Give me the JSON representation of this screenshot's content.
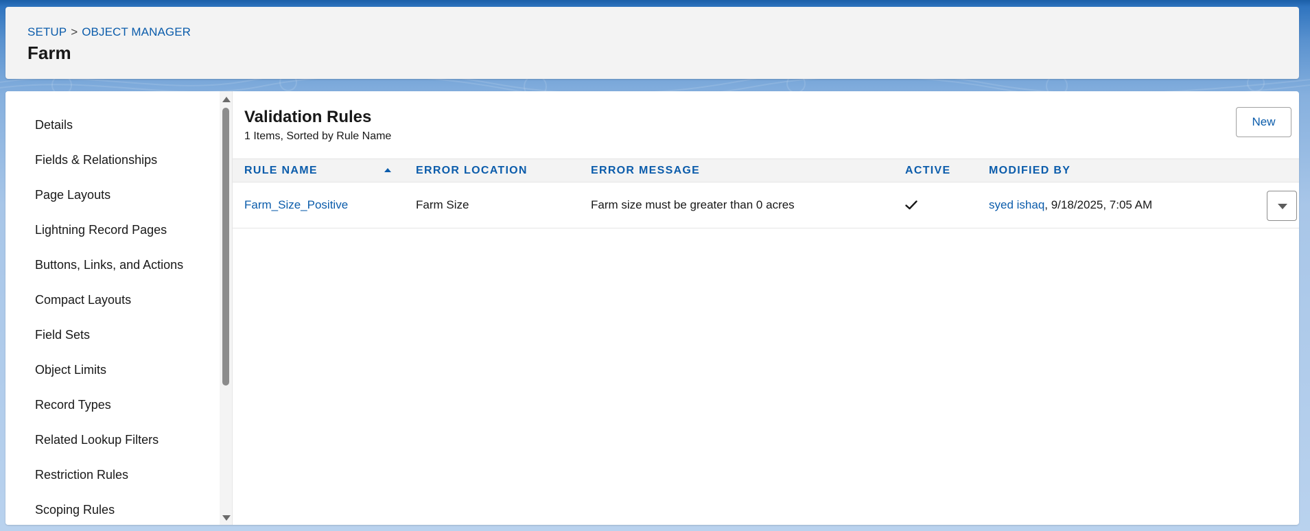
{
  "breadcrumb": {
    "setup": "SETUP",
    "separator": ">",
    "object_manager": "OBJECT MANAGER"
  },
  "page_title": "Farm",
  "sidebar": {
    "items": [
      {
        "label": "Details"
      },
      {
        "label": "Fields & Relationships"
      },
      {
        "label": "Page Layouts"
      },
      {
        "label": "Lightning Record Pages"
      },
      {
        "label": "Buttons, Links, and Actions"
      },
      {
        "label": "Compact Layouts"
      },
      {
        "label": "Field Sets"
      },
      {
        "label": "Object Limits"
      },
      {
        "label": "Record Types"
      },
      {
        "label": "Related Lookup Filters"
      },
      {
        "label": "Restriction Rules"
      },
      {
        "label": "Scoping Rules"
      }
    ]
  },
  "main": {
    "title": "Validation Rules",
    "subtitle": "1 Items, Sorted by Rule Name",
    "new_button": "New",
    "columns": {
      "rule_name": "RULE NAME",
      "error_location": "ERROR LOCATION",
      "error_message": "ERROR MESSAGE",
      "active": "ACTIVE",
      "modified_by": "MODIFIED BY"
    },
    "sort": {
      "column": "rule_name",
      "direction": "ascending"
    },
    "rows": [
      {
        "rule_name": "Farm_Size_Positive",
        "error_location": "Farm Size",
        "error_message": "Farm size must be greater than 0 acres",
        "active": true,
        "modified_by_user": "syed ishaq",
        "modified_by_date": ", 9/18/2025, 7:05 AM"
      }
    ]
  },
  "icons": {
    "sort": "sort-ascending-icon",
    "check": "check-icon",
    "row_menu": "chevron-down-icon",
    "scroll_up": "scroll-up-arrow-icon",
    "scroll_down": "scroll-down-arrow-icon"
  },
  "colors": {
    "link": "#0b5cab",
    "header_bg": "#f3f3f3",
    "brand_top": "#1b5fa8"
  }
}
